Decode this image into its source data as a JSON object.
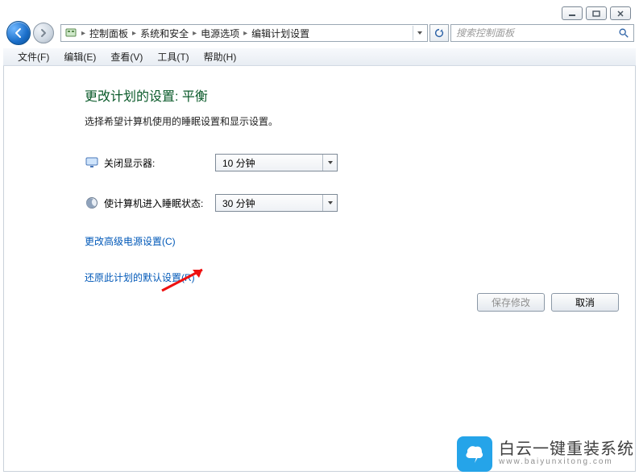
{
  "breadcrumb": {
    "items": [
      "控制面板",
      "系统和安全",
      "电源选项",
      "编辑计划设置"
    ]
  },
  "search": {
    "placeholder": "搜索控制面板"
  },
  "menu": {
    "file": "文件(F)",
    "edit": "编辑(E)",
    "view": "查看(V)",
    "tools": "工具(T)",
    "help": "帮助(H)"
  },
  "page": {
    "title": "更改计划的设置: 平衡",
    "desc": "选择希望计算机使用的睡眠设置和显示设置。"
  },
  "fields": {
    "display_off": {
      "label": "关闭显示器:",
      "value": "10 分钟"
    },
    "sleep": {
      "label": "使计算机进入睡眠状态:",
      "value": "30 分钟"
    }
  },
  "links": {
    "advanced": "更改高级电源设置(C)",
    "restore": "还原此计划的默认设置(R)"
  },
  "buttons": {
    "save": "保存修改",
    "cancel": "取消"
  },
  "watermark": {
    "cn": "白云一键重装系统",
    "en": "www.baiyunxitong.com"
  }
}
